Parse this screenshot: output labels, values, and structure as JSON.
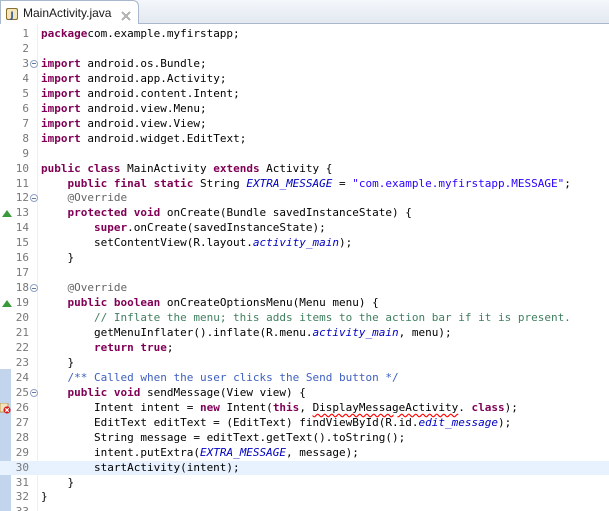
{
  "tab": {
    "title": "MainActivity.java",
    "icon": "java-file-icon",
    "close_icon": "close-icon"
  },
  "current_line": 30,
  "lines": [
    {
      "n": "1",
      "segs": [
        [
          "kw",
          "package"
        ],
        [
          "",
          "com.example.myfirstapp;"
        ]
      ]
    },
    {
      "n": "2",
      "segs": []
    },
    {
      "n": "3",
      "fold": true,
      "segs": [
        [
          "kw",
          "import"
        ],
        [
          "",
          " android.os.Bundle;"
        ]
      ]
    },
    {
      "n": "4",
      "segs": [
        [
          "kw",
          "import"
        ],
        [
          "",
          " android.app.Activity;"
        ]
      ]
    },
    {
      "n": "5",
      "segs": [
        [
          "kw",
          "import"
        ],
        [
          "",
          " android.content.Intent;"
        ]
      ]
    },
    {
      "n": "6",
      "segs": [
        [
          "kw",
          "import"
        ],
        [
          "",
          " android.view.Menu;"
        ]
      ]
    },
    {
      "n": "7",
      "segs": [
        [
          "kw",
          "import"
        ],
        [
          "",
          " android.view.View;"
        ]
      ]
    },
    {
      "n": "8",
      "segs": [
        [
          "kw",
          "import"
        ],
        [
          "",
          " android.widget.EditText;"
        ]
      ]
    },
    {
      "n": "9",
      "segs": []
    },
    {
      "n": "10",
      "segs": [
        [
          "kw",
          "public class"
        ],
        [
          "",
          " MainActivity "
        ],
        [
          "kw",
          "extends"
        ],
        [
          "",
          " Activity {"
        ]
      ]
    },
    {
      "n": "11",
      "segs": [
        [
          "",
          "    "
        ],
        [
          "kw",
          "public final static"
        ],
        [
          "",
          " String "
        ],
        [
          "fld",
          "EXTRA_MESSAGE"
        ],
        [
          "",
          " = "
        ],
        [
          "str",
          "\"com.example.myfirstapp.MESSAGE\""
        ],
        [
          "",
          ";"
        ]
      ]
    },
    {
      "n": "12",
      "fold": true,
      "segs": [
        [
          "",
          "    "
        ],
        [
          "ann",
          "@Override"
        ]
      ]
    },
    {
      "n": "13",
      "marker": "override",
      "segs": [
        [
          "",
          "    "
        ],
        [
          "kw",
          "protected void"
        ],
        [
          "",
          " onCreate(Bundle savedInstanceState) {"
        ]
      ]
    },
    {
      "n": "14",
      "segs": [
        [
          "",
          "        "
        ],
        [
          "kw",
          "super"
        ],
        [
          "",
          ".onCreate(savedInstanceState);"
        ]
      ]
    },
    {
      "n": "15",
      "segs": [
        [
          "",
          "        setContentView(R.layout."
        ],
        [
          "fld",
          "activity_main"
        ],
        [
          "",
          ");"
        ]
      ]
    },
    {
      "n": "16",
      "segs": [
        [
          "",
          "    }"
        ]
      ]
    },
    {
      "n": "17",
      "segs": []
    },
    {
      "n": "18",
      "fold": true,
      "segs": [
        [
          "",
          "    "
        ],
        [
          "ann",
          "@Override"
        ]
      ]
    },
    {
      "n": "19",
      "marker": "override",
      "segs": [
        [
          "",
          "    "
        ],
        [
          "kw",
          "public boolean"
        ],
        [
          "",
          " onCreateOptionsMenu(Menu menu) {"
        ]
      ]
    },
    {
      "n": "20",
      "segs": [
        [
          "",
          "        "
        ],
        [
          "cmt",
          "// Inflate the menu; this adds items to the action bar if it is present."
        ]
      ]
    },
    {
      "n": "21",
      "segs": [
        [
          "",
          "        getMenuInflater().inflate(R.menu."
        ],
        [
          "fld",
          "activity_main"
        ],
        [
          "",
          ", menu);"
        ]
      ]
    },
    {
      "n": "22",
      "segs": [
        [
          "",
          "        "
        ],
        [
          "kw",
          "return true"
        ],
        [
          "",
          ";"
        ]
      ]
    },
    {
      "n": "23",
      "segs": [
        [
          "",
          "    }"
        ]
      ]
    },
    {
      "n": "24",
      "segs": [
        [
          "",
          "    "
        ],
        [
          "jdoc",
          "/** Called when the user clicks the Send button */"
        ]
      ]
    },
    {
      "n": "25",
      "fold": true,
      "segs": [
        [
          "",
          "    "
        ],
        [
          "kw",
          "public void"
        ],
        [
          "",
          " sendMessage(View view) {"
        ]
      ]
    },
    {
      "n": "26",
      "marker": "error",
      "segs": [
        [
          "",
          "        Intent intent = "
        ],
        [
          "kw",
          "new"
        ],
        [
          "",
          " Intent("
        ],
        [
          "kw",
          "this"
        ],
        [
          ",",
          ", "
        ],
        [
          "err",
          "DisplayMessageActivity"
        ],
        [
          "",
          ". "
        ],
        [
          "kw",
          "class"
        ],
        [
          "",
          ");"
        ]
      ]
    },
    {
      "n": "27",
      "segs": [
        [
          "",
          "        EditText editText = (EditText) findViewById(R.id."
        ],
        [
          "fld",
          "edit_message"
        ],
        [
          "",
          ");"
        ]
      ]
    },
    {
      "n": "28",
      "segs": [
        [
          "",
          "        String message = editText.getText().toString();"
        ]
      ]
    },
    {
      "n": "29",
      "segs": [
        [
          "",
          "        intent.putExtra("
        ],
        [
          "fld",
          "EXTRA_MESSAGE"
        ],
        [
          "",
          ", message);"
        ]
      ]
    },
    {
      "n": "30",
      "segs": [
        [
          "",
          "        startActivity(intent);"
        ]
      ]
    },
    {
      "n": "31",
      "segs": [
        [
          "",
          "    }"
        ]
      ]
    },
    {
      "n": "32",
      "segs": [
        [
          "",
          "}"
        ]
      ]
    },
    {
      "n": "33",
      "segs": []
    }
  ]
}
